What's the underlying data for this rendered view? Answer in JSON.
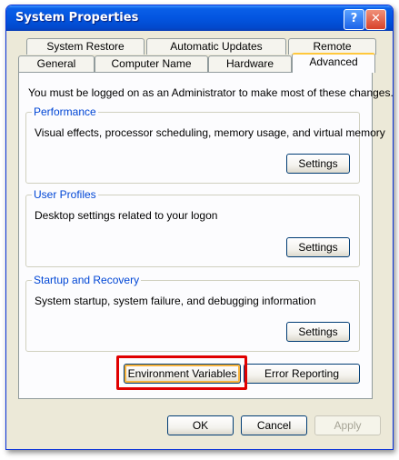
{
  "window": {
    "title": "System Properties",
    "help_glyph": "?",
    "close_glyph": "✕"
  },
  "tabs": {
    "row_back": [
      "System Restore",
      "Automatic Updates",
      "Remote"
    ],
    "row_front": [
      "General",
      "Computer Name",
      "Hardware",
      "Advanced"
    ],
    "active": "Advanced"
  },
  "advanced": {
    "intro": "You must be logged on as an Administrator to make most of these changes.",
    "performance": {
      "title": "Performance",
      "description": "Visual effects, processor scheduling, memory usage, and virtual memory",
      "button": "Settings"
    },
    "user_profiles": {
      "title": "User Profiles",
      "description": "Desktop settings related to your logon",
      "button": "Settings"
    },
    "startup_recovery": {
      "title": "Startup and Recovery",
      "description": "System startup, system failure, and debugging information",
      "button": "Settings"
    },
    "environment_variables_button": "Environment Variables",
    "error_reporting_button": "Error Reporting"
  },
  "footer": {
    "ok": "OK",
    "cancel": "Cancel",
    "apply": "Apply"
  },
  "colors": {
    "titlebar": "#0355e0",
    "highlight": "#e00000",
    "group_title": "#0046d5"
  }
}
